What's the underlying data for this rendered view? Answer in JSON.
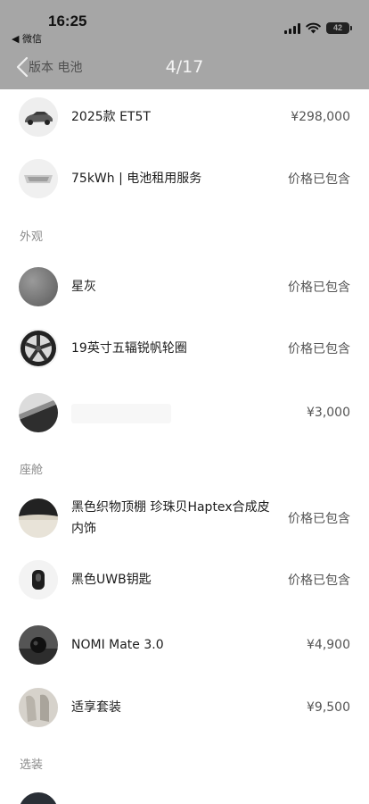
{
  "status": {
    "time": "16:25",
    "back_app": "◀ 微信",
    "battery": "42"
  },
  "nav": {
    "subtitle": "版本 电池",
    "counter": "4/17"
  },
  "rows": [
    {
      "name": "2025款 ET5T",
      "price": "¥298,000",
      "icon": "car-thumb"
    },
    {
      "name": "75kWh | 电池租用服务",
      "price": "价格已包含",
      "icon": "battery-pack-thumb"
    },
    {
      "name": "星灰",
      "price": "价格已包含",
      "icon": "color-swatch-thumb"
    },
    {
      "name": "19英寸五辐锐帆轮圈",
      "price": "价格已包含",
      "icon": "wheel-thumb"
    },
    {
      "name": "",
      "price": "¥3,000",
      "icon": "roof-thumb"
    },
    {
      "name": "黑色织物顶棚 珍珠贝Haptex合成皮内饰",
      "price": "价格已包含",
      "icon": "interior-thumb"
    },
    {
      "name": "黑色UWB钥匙",
      "price": "价格已包含",
      "icon": "key-thumb"
    },
    {
      "name": "NOMI Mate 3.0",
      "price": "¥4,900",
      "icon": "nomi-thumb"
    },
    {
      "name": "适享套装",
      "price": "¥9,500",
      "icon": "seat-package-thumb"
    }
  ],
  "sections": {
    "exterior": "外观",
    "cabin": "座舱",
    "options": "选装"
  }
}
